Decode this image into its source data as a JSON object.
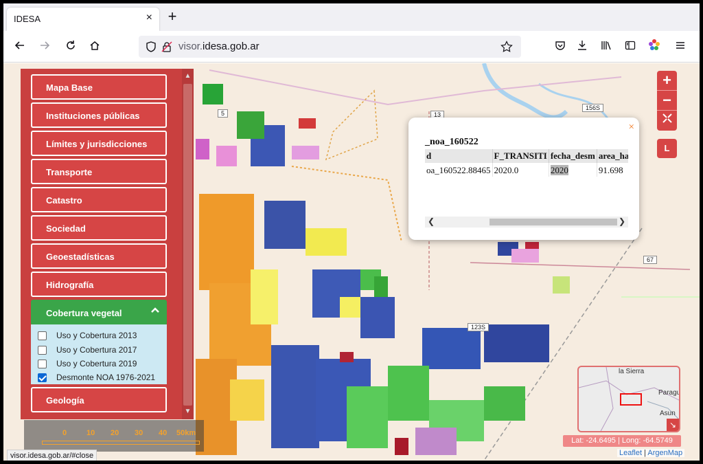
{
  "browser": {
    "tab_title": "IDESA",
    "tab_close": "×",
    "new_tab": "+",
    "url_domain": "visor.",
    "url_host": "idesa.gob.ar",
    "status_url": "visor.idesa.gob.ar/#close"
  },
  "panel": {
    "categories": [
      "Mapa Base",
      "Instituciones públicas",
      "Límites y jurisdicciones",
      "Transporte",
      "Catastro",
      "Sociedad",
      "Geoestadísticas",
      "Hidrografía",
      "Cobertura vegetal",
      "Geología"
    ],
    "active_category": "Cobertura vegetal",
    "sublayers": [
      {
        "label": "Uso y Cobertura 2013",
        "checked": false
      },
      {
        "label": "Uso y Cobertura 2017",
        "checked": false
      },
      {
        "label": "Uso y Cobertura 2019",
        "checked": false
      },
      {
        "label": "Desmonte NOA 1976-2021",
        "checked": true
      }
    ]
  },
  "map_controls": {
    "zoom_in": "+",
    "zoom_out": "−",
    "fullscreen": "⛶",
    "layers_button": "L"
  },
  "popup": {
    "close": "×",
    "title": "_noa_160522",
    "columns": [
      "d",
      "F_TRANSITI",
      "fecha_desm",
      "area_ha"
    ],
    "row": [
      "oa_160522.88465",
      "2020.0",
      "2020",
      "91.698"
    ]
  },
  "road_labels": [
    "5",
    "13",
    "156S",
    "67",
    "123S"
  ],
  "minimap": {
    "labels": [
      "la Sierra",
      "Paragu",
      "Asun"
    ],
    "toggle": "↘"
  },
  "coords": "Lat: -24.6495 | Long: -64.5749",
  "attribution": {
    "leaflet": "Leaflet",
    "sep": "|",
    "argenmap": "ArgenMap"
  },
  "scale": {
    "labels": [
      "0",
      "10",
      "20",
      "30",
      "40",
      "50km"
    ]
  }
}
